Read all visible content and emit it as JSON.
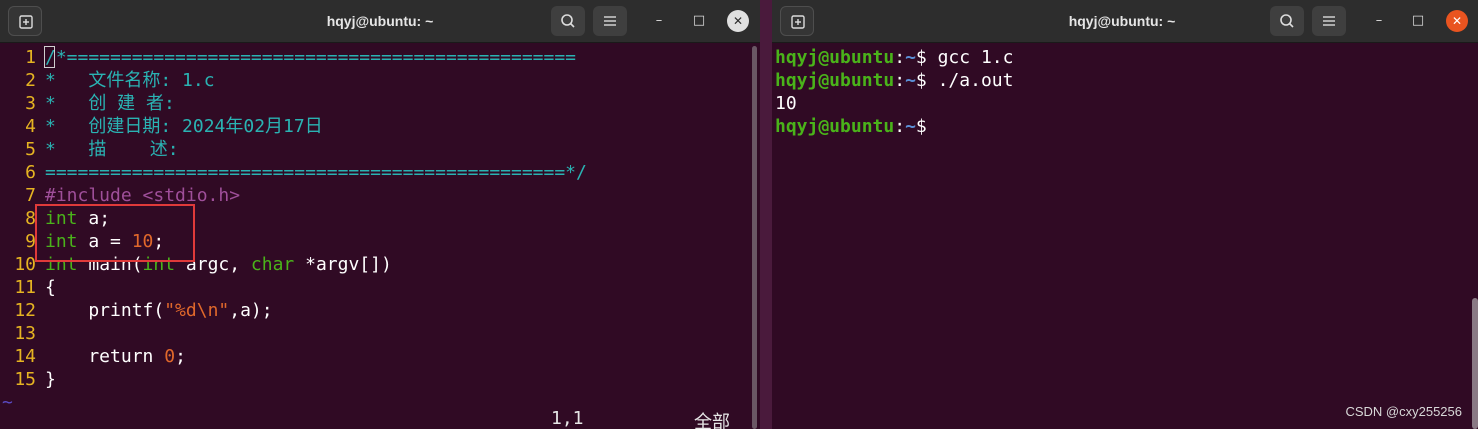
{
  "left_window": {
    "title": "hqyj@ubuntu: ~",
    "code": [
      {
        "n": "1",
        "parts": [
          {
            "t": "/*===============================================",
            "c": "c-comment"
          }
        ]
      },
      {
        "n": "2",
        "parts": [
          {
            "t": "*   文件名称: 1.c",
            "c": "c-comment"
          }
        ]
      },
      {
        "n": "3",
        "parts": [
          {
            "t": "*   创 建 者:",
            "c": "c-comment"
          }
        ]
      },
      {
        "n": "4",
        "parts": [
          {
            "t": "*   创建日期: 2024年02月17日",
            "c": "c-comment"
          }
        ]
      },
      {
        "n": "5",
        "parts": [
          {
            "t": "*   描    述:",
            "c": "c-comment"
          }
        ]
      },
      {
        "n": "6",
        "parts": [
          {
            "t": "================================================*/",
            "c": "c-comment"
          }
        ]
      },
      {
        "n": "7",
        "parts": [
          {
            "t": "#include <stdio.h>",
            "c": "c-pre"
          }
        ]
      },
      {
        "n": "8",
        "parts": [
          {
            "t": "int",
            "c": "c-type"
          },
          {
            "t": " a;",
            "c": ""
          }
        ]
      },
      {
        "n": "9",
        "parts": [
          {
            "t": "int",
            "c": "c-type"
          },
          {
            "t": " a = ",
            "c": ""
          },
          {
            "t": "10",
            "c": "c-num"
          },
          {
            "t": ";",
            "c": ""
          }
        ]
      },
      {
        "n": "10",
        "parts": [
          {
            "t": "int",
            "c": "c-type"
          },
          {
            "t": " main(",
            "c": ""
          },
          {
            "t": "int",
            "c": "c-type"
          },
          {
            "t": " argc, ",
            "c": ""
          },
          {
            "t": "char",
            "c": "c-type"
          },
          {
            "t": " *argv[])",
            "c": ""
          }
        ]
      },
      {
        "n": "11",
        "parts": [
          {
            "t": "{",
            "c": ""
          }
        ]
      },
      {
        "n": "12",
        "parts": [
          {
            "t": "    printf(",
            "c": ""
          },
          {
            "t": "\"%d\\n\"",
            "c": "c-str"
          },
          {
            "t": ",a);",
            "c": ""
          }
        ]
      },
      {
        "n": "13",
        "parts": []
      },
      {
        "n": "14",
        "parts": [
          {
            "t": "    return ",
            "c": ""
          },
          {
            "t": "0",
            "c": "c-num"
          },
          {
            "t": ";",
            "c": ""
          }
        ]
      },
      {
        "n": "15",
        "parts": [
          {
            "t": "}",
            "c": ""
          }
        ]
      }
    ],
    "tilde": "~",
    "status_pos": "1,1",
    "status_all": "全部"
  },
  "right_window": {
    "title": "hqyj@ubuntu: ~",
    "lines": [
      {
        "user": "hqyj@ubuntu",
        "path": "~",
        "sym": "$ ",
        "cmd": "gcc 1.c"
      },
      {
        "user": "hqyj@ubuntu",
        "path": "~",
        "sym": "$ ",
        "cmd": "./a.out"
      },
      {
        "out": "10"
      },
      {
        "user": "hqyj@ubuntu",
        "path": "~",
        "sym": "$ ",
        "cmd": ""
      }
    ]
  },
  "icons": {
    "new_tab": "new-tab-icon",
    "search": "search-icon",
    "menu": "hamburger-menu-icon",
    "minimize": "minimize-icon",
    "maximize": "maximize-icon",
    "close": "close-icon"
  },
  "watermark": "CSDN @cxy255256"
}
